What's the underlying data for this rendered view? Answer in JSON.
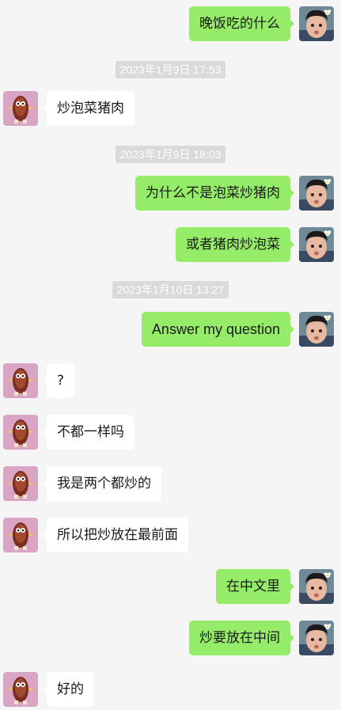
{
  "chat": {
    "m1": "晚饭吃的什么",
    "t1": "2023年1月9日 17:53",
    "m2": "炒泡菜猪肉",
    "t2": "2023年1月9日 18:03",
    "m3": "为什么不是泡菜炒猪肉",
    "m4": "或者猪肉炒泡菜",
    "t3": "2023年1月10日 13:27",
    "m5": "Answer my question",
    "m6": "?",
    "m7": "不都一样吗",
    "m8": "我是两个都炒的",
    "m9": "所以把炒放在最前面",
    "m10": "在中文里",
    "m11": "炒要放在中间",
    "m12": "好的"
  },
  "colors": {
    "background": "#f5f5f5",
    "sent_bubble": "#95ec69",
    "received_bubble": "#ffffff",
    "timestamp_bg": "#dadada"
  },
  "icons": {
    "self_avatar": "toddler-photo-avatar",
    "contact_avatar": "cartoon-figure-avatar"
  }
}
